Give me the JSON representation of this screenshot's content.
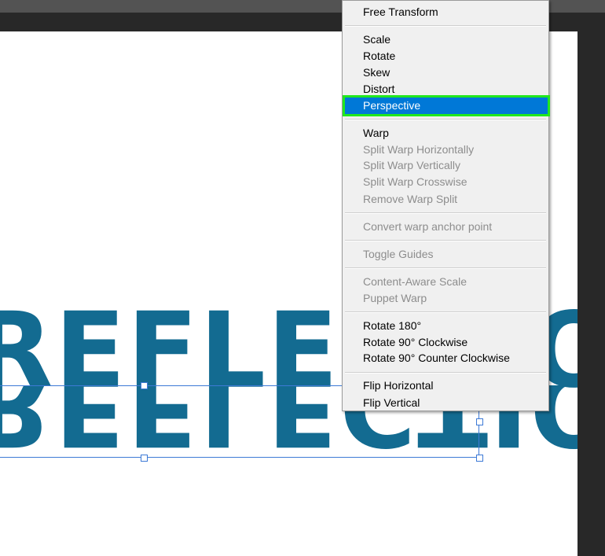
{
  "canvas": {
    "text": "REFLECTION",
    "text_color": "#136b91"
  },
  "menu": {
    "highlight_color": "#0078d7",
    "highlight_outline_color": "#21e81d",
    "items": {
      "free_transform": "Free Transform",
      "scale": "Scale",
      "rotate": "Rotate",
      "skew": "Skew",
      "distort": "Distort",
      "perspective": "Perspective",
      "warp": "Warp",
      "split_warp_horizontally": "Split Warp Horizontally",
      "split_warp_vertically": "Split Warp Vertically",
      "split_warp_crosswise": "Split Warp Crosswise",
      "remove_warp_split": "Remove Warp Split",
      "convert_warp_anchor_point": "Convert warp anchor point",
      "toggle_guides": "Toggle Guides",
      "content_aware_scale": "Content-Aware Scale",
      "puppet_warp": "Puppet Warp",
      "rotate_180": "Rotate 180°",
      "rotate_90_cw": "Rotate 90° Clockwise",
      "rotate_90_ccw": "Rotate 90° Counter Clockwise",
      "flip_horizontal": "Flip Horizontal",
      "flip_vertical": "Flip Vertical"
    }
  }
}
